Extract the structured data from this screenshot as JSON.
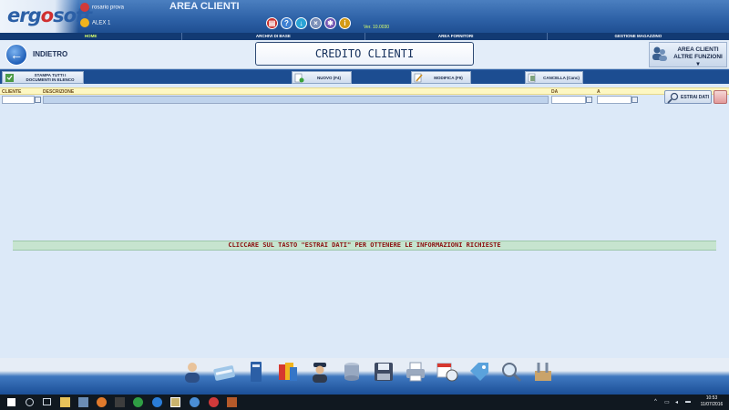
{
  "header": {
    "logo": {
      "pre": "erg",
      "o": "o",
      "post": "soft"
    },
    "user_company": "rosario prova",
    "user_name": "ALEX 1",
    "area_title": "AREA CLIENTI",
    "version": "Ver. 10.0030",
    "icons": [
      "pdf-icon",
      "help-icon",
      "download-icon",
      "close-icon",
      "settings-icon",
      "info-icon"
    ]
  },
  "menu": {
    "items": [
      "HOME",
      "ARCHIVI DI BASE",
      "AREA FORNITORI",
      "GESTIONE MAGAZZINO"
    ]
  },
  "title_row": {
    "back_label": "INDIETRO",
    "title": "CREDITO CLIENTI",
    "right_menu_line1": "AREA CLIENTI",
    "right_menu_line2": "ALTRE FUNZIONI"
  },
  "toolbar": {
    "print_all_line1": "STAMPA TUTTI I",
    "print_all_line2": "DOCUMENTI IN ELENCO",
    "new": "NUOVO (F4)",
    "modify": "MODIFICA (F9)",
    "delete": "CANCELLA (Canc)"
  },
  "filter": {
    "cliente_label": "CLIENTE",
    "descrizione_label": "DESCRIZIONE",
    "da_label": "DA",
    "a_label": "A",
    "cliente_value": "",
    "descrizione_value": "",
    "da_value": "",
    "a_value": "",
    "extract_label": "ESTRAI DATI"
  },
  "message": "CLICCARE SUL TASTO \"ESTRAI DATI\" PER OTTENERE LE INFORMAZIONI RICHIESTE",
  "dock": {
    "icons": [
      "clients-icon",
      "payment-card-icon",
      "binder-icon",
      "colors-icon",
      "agent-icon",
      "database-icon",
      "save-icon",
      "printer-icon",
      "calendar-clock-icon",
      "price-tag-icon",
      "search-icon",
      "tools-icon"
    ]
  },
  "taskbar": {
    "time": "10:53",
    "date": "11/07/2016"
  },
  "colors": {
    "header_blue": "#2f63a8",
    "menu_navy": "#123a73",
    "message_red": "#8a1010",
    "message_bg": "#c6e4cf"
  }
}
